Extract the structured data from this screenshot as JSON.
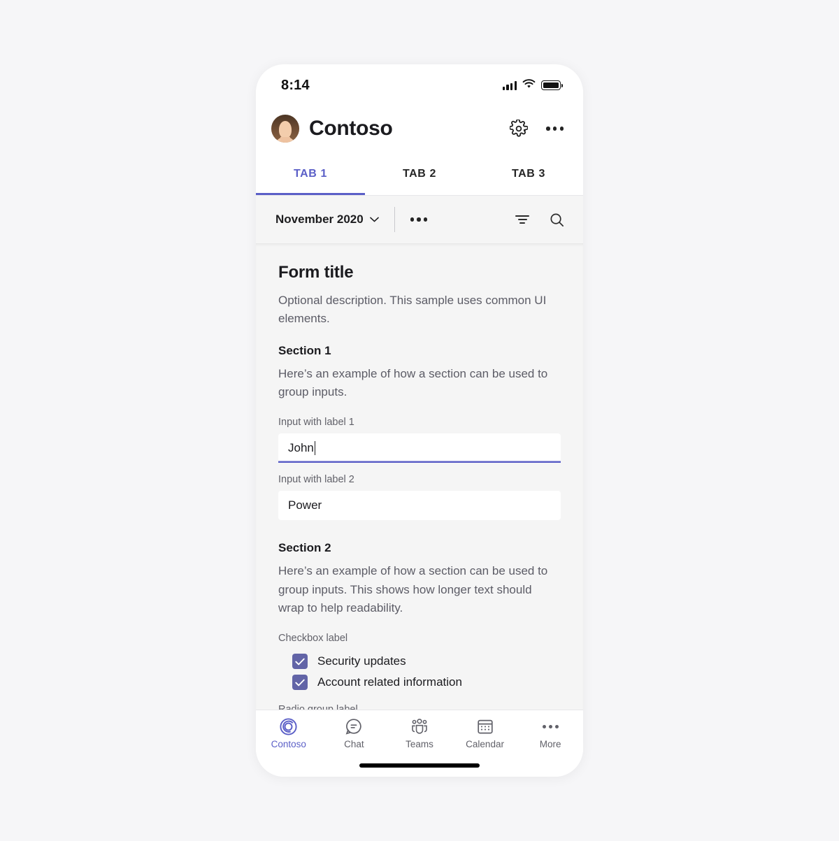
{
  "status_bar": {
    "time": "8:14",
    "signal_icon": "cellular-signal-icon",
    "wifi_icon": "wifi-icon",
    "battery_icon": "battery-full-icon"
  },
  "header": {
    "avatar_icon": "user-avatar",
    "title": "Contoso",
    "settings_icon": "gear-icon",
    "overflow_icon": "more-horizontal-icon"
  },
  "tabs": [
    {
      "label": "TAB 1",
      "active": true
    },
    {
      "label": "TAB 2",
      "active": false
    },
    {
      "label": "TAB 3",
      "active": false
    }
  ],
  "toolbar": {
    "month_label": "November 2020",
    "chevron_icon": "chevron-down-icon",
    "overflow_icon": "more-horizontal-icon",
    "filter_icon": "filter-icon",
    "search_icon": "search-icon"
  },
  "form": {
    "title": "Form title",
    "description": "Optional description. This sample uses common UI elements.",
    "section1": {
      "title": "Section 1",
      "description": "Here’s an example of how a section can be used to group inputs.",
      "input1": {
        "label": "Input with label 1",
        "value": "John",
        "focused": true
      },
      "input2": {
        "label": "Input with label 2",
        "value": "Power",
        "focused": false
      }
    },
    "section2": {
      "title": "Section 2",
      "description": "Here’s an example of how a section can be used to group inputs. This shows how longer text should wrap to help readability.",
      "checkbox_group_label": "Checkbox label",
      "checkboxes": [
        {
          "label": "Security updates",
          "checked": true
        },
        {
          "label": "Account related information",
          "checked": true
        }
      ],
      "radio_group_label": "Radio group label"
    }
  },
  "bottom_nav": [
    {
      "label": "Contoso",
      "icon": "contoso-spiral-icon",
      "active": true
    },
    {
      "label": "Chat",
      "icon": "chat-bubble-icon",
      "active": false
    },
    {
      "label": "Teams",
      "icon": "teams-people-icon",
      "active": false
    },
    {
      "label": "Calendar",
      "icon": "calendar-icon",
      "active": false
    },
    {
      "label": "More",
      "icon": "more-horizontal-icon",
      "active": false
    }
  ],
  "colors": {
    "accent": "#5b5fc7",
    "checkbox": "#6264a7",
    "text_primary": "#1b1b1f",
    "text_secondary": "#5c5c66",
    "surface": "#ffffff",
    "canvas": "#f5f5f5",
    "page_background": "#f6f6f8"
  }
}
